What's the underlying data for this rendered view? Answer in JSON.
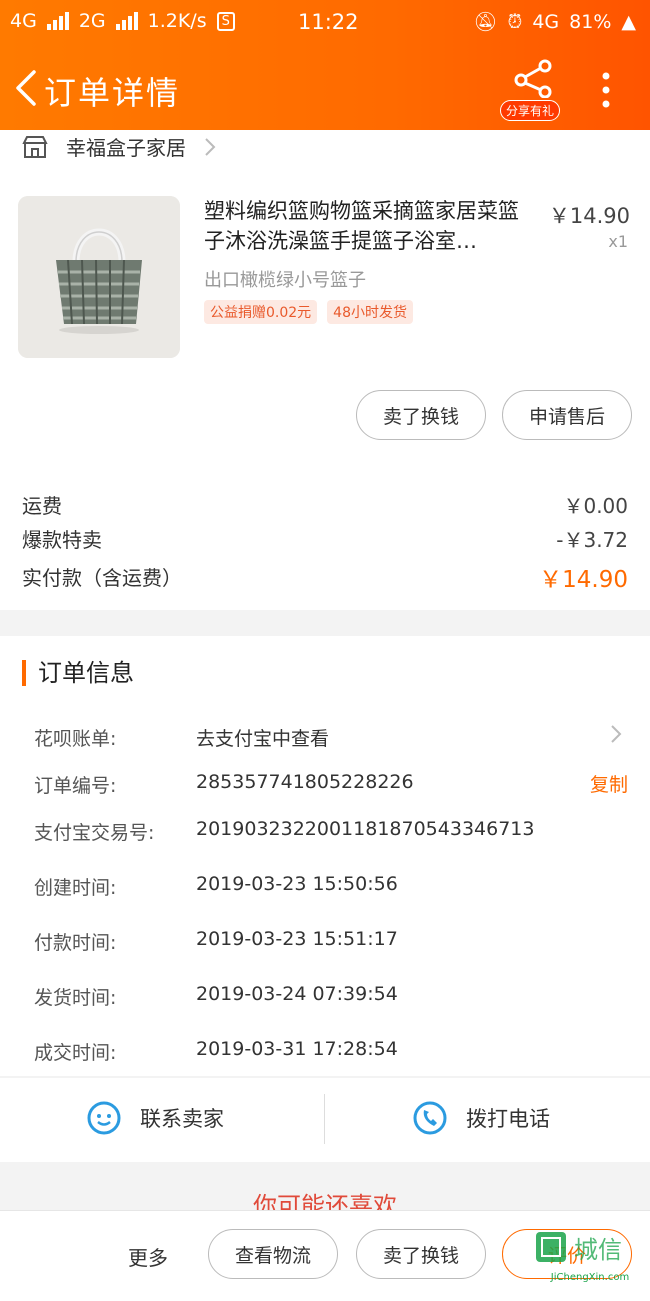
{
  "status_bar": {
    "network1": "4G",
    "network2": "2G",
    "speed": "1.2K/s",
    "time": "11:22",
    "network3": "4G",
    "battery": "81%"
  },
  "header": {
    "title": "订单详情",
    "share_label": "分享有礼"
  },
  "shop": {
    "name": "幸福盒子家居"
  },
  "product": {
    "title": "塑料编织篮购物篮采摘篮家居菜篮子沐浴洗澡篮手提篮子浴室…",
    "sku": "出口橄榄绿小号篮子",
    "price": "￥14.90",
    "quantity": "x1",
    "tags": [
      "公益捐赠0.02元",
      "48小时发货"
    ]
  },
  "product_actions": {
    "exchange": "卖了换钱",
    "after_sales": "申请售后"
  },
  "fees": {
    "shipping_label": "运费",
    "shipping_value": "￥0.00",
    "discount_label": "爆款特卖",
    "discount_value": "-￥3.72",
    "paid_label": "实付款（含运费）",
    "paid_value": "￥14.90"
  },
  "order_info": {
    "title": "订单信息",
    "copy_label": "复制",
    "rows": [
      {
        "label": "花呗账单:",
        "value": "去支付宝中查看"
      },
      {
        "label": "订单编号:",
        "value": "285357741805228226"
      },
      {
        "label": "支付宝交易号:",
        "value": "2019032322001181870543346713"
      },
      {
        "label": "创建时间:",
        "value": "2019-03-23 15:50:56"
      },
      {
        "label": "付款时间:",
        "value": "2019-03-23 15:51:17"
      },
      {
        "label": "发货时间:",
        "value": "2019-03-24 07:39:54"
      },
      {
        "label": "成交时间:",
        "value": "2019-03-31 17:28:54"
      }
    ]
  },
  "contact": {
    "seller": "联系卖家",
    "call": "拨打电话"
  },
  "recommend": {
    "title": "你可能还喜欢"
  },
  "bottom_bar": {
    "more": "更多",
    "logistics": "查看物流",
    "exchange": "卖了换钱",
    "review": "评价"
  },
  "watermark": {
    "text": "JiChengXin.com"
  },
  "colors": {
    "accent": "#ff6a00",
    "tag_bg": "#fde9e2",
    "header_bg": "#ff7a00"
  }
}
